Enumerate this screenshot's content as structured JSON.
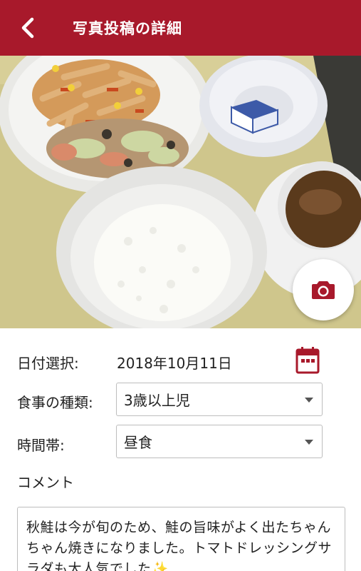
{
  "header": {
    "title": "写真投稿の詳細",
    "back_icon": "chevron-left-icon",
    "background_color": "#a8192b"
  },
  "photo": {
    "camera_icon": "camera-icon",
    "accent_color": "#a8192b"
  },
  "form": {
    "date_label": "日付選択:",
    "date_value": "2018年10月11日",
    "calendar_icon": "calendar-icon",
    "meal_type_label": "食事の種類:",
    "meal_type_value": "3歳以上児",
    "time_label": "時間帯:",
    "time_value": "昼食",
    "comment_label": "コメント",
    "comment_text": "秋鮭は今が旬のため、鮭の旨味がよく出たちゃんちゃん焼きになりました。トマトドレッシングサラダも大人気でした",
    "comment_emoji": "✨"
  }
}
